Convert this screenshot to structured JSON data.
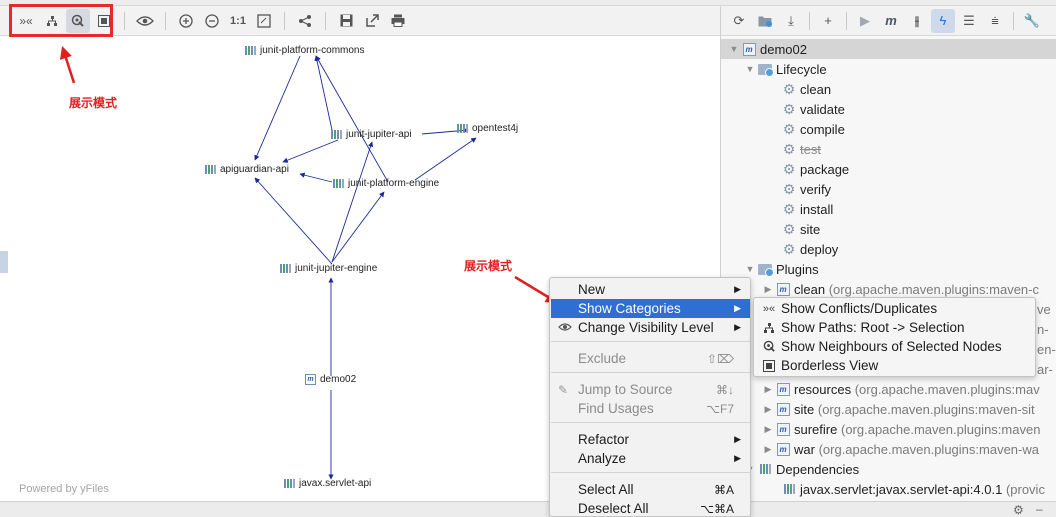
{
  "diagram": {
    "toolbar": {
      "zoom_actual": "1:1"
    },
    "annotation_1": "展示模式",
    "annotation_2": "展示模式",
    "powered_by": "Powered by yFiles",
    "nodes": {
      "commons": "junit-platform-commons",
      "jupiter_api": "junit-jupiter-api",
      "opentest4j": "opentest4j",
      "apiguardian": "apiguardian-api",
      "platform_engine": "junit-platform-engine",
      "jupiter_engine": "junit-jupiter-engine",
      "demo02": "demo02",
      "servlet": "javax.servlet-api"
    }
  },
  "maven": {
    "tree": [
      {
        "label": "demo02",
        "extra": ""
      },
      {
        "label": "Lifecycle",
        "extra": ""
      },
      {
        "label": "clean",
        "extra": ""
      },
      {
        "label": "validate",
        "extra": ""
      },
      {
        "label": "compile",
        "extra": ""
      },
      {
        "label": "test",
        "extra": ""
      },
      {
        "label": "package",
        "extra": ""
      },
      {
        "label": "verify",
        "extra": ""
      },
      {
        "label": "install",
        "extra": ""
      },
      {
        "label": "site",
        "extra": ""
      },
      {
        "label": "deploy",
        "extra": ""
      },
      {
        "label": "Plugins",
        "extra": ""
      },
      {
        "label": "clean",
        "extra": "(org.apache.maven.plugins:maven-c"
      },
      {
        "label": "resources",
        "extra": "(org.apache.maven.plugins:mav"
      },
      {
        "label": "site",
        "extra": "(org.apache.maven.plugins:maven-sit"
      },
      {
        "label": "surefire",
        "extra": "(org.apache.maven.plugins:maven"
      },
      {
        "label": "war",
        "extra": "(org.apache.maven.plugins:maven-wa"
      },
      {
        "label": "Dependencies",
        "extra": ""
      },
      {
        "label": "javax.servlet:javax.servlet-api:4.0.1",
        "extra": "(provic"
      }
    ],
    "peek": [
      "ve",
      "n-",
      "en-",
      "ar-"
    ]
  },
  "context_menu": {
    "new": "New",
    "show_categories": "Show Categories",
    "change_visibility": "Change Visibility Level",
    "exclude": "Exclude",
    "exclude_shortcut": "⇧⌦",
    "jump_to_source": "Jump to Source",
    "jump_shortcut": "⌘↓",
    "find_usages": "Find Usages",
    "find_shortcut": "⌥F7",
    "refactor": "Refactor",
    "analyze": "Analyze",
    "select_all": "Select All",
    "select_all_shortcut": "⌘A",
    "deselect_all": "Deselect All",
    "deselect_all_shortcut": "⌥⌘A"
  },
  "submenu": {
    "conflicts": "Show Conflicts/Duplicates",
    "paths": "Show Paths: Root -> Selection",
    "neighbours": "Show Neighbours of Selected Nodes",
    "borderless": "Borderless View"
  }
}
